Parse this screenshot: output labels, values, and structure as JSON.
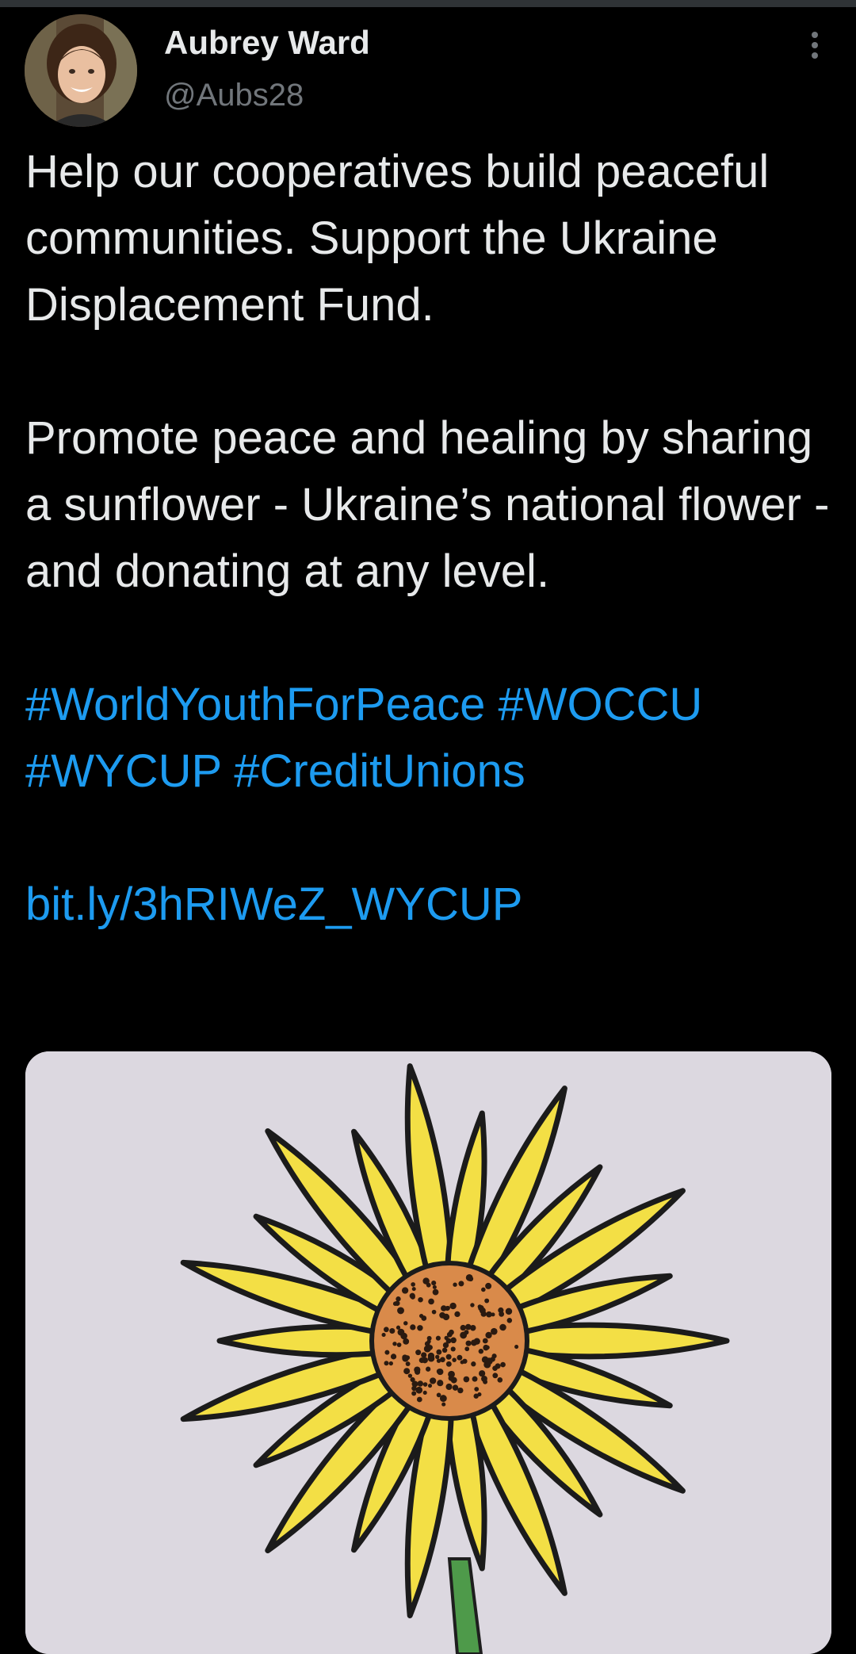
{
  "tweet": {
    "author": {
      "display_name": "Aubrey Ward",
      "handle": "@Aubs28",
      "avatar_icon": "profile-photo"
    },
    "more_icon": "more-vertical-icon",
    "text": {
      "paragraph_1": "Help our cooperatives build peaceful communities. Support the Ukraine Displacement Fund.",
      "paragraph_2": "Promote peace and healing by sharing a sunflower - Ukraine’s national flower - and donating at any level.",
      "hashtags": [
        "#WorldYouthForPeace",
        "#WOCCU",
        "#WYCUP",
        "#CreditUnions"
      ],
      "link": "bit.ly/3hRIWeZ_WYCUP"
    },
    "media": {
      "description_icon": "sunflower-drawing-image"
    }
  },
  "colors": {
    "background": "#000000",
    "text_primary": "#e7e9ea",
    "text_secondary": "#71767b",
    "link_blue": "#1d9bf0",
    "petal_yellow": "#f2e04a",
    "center_orange": "#d98a4a"
  }
}
